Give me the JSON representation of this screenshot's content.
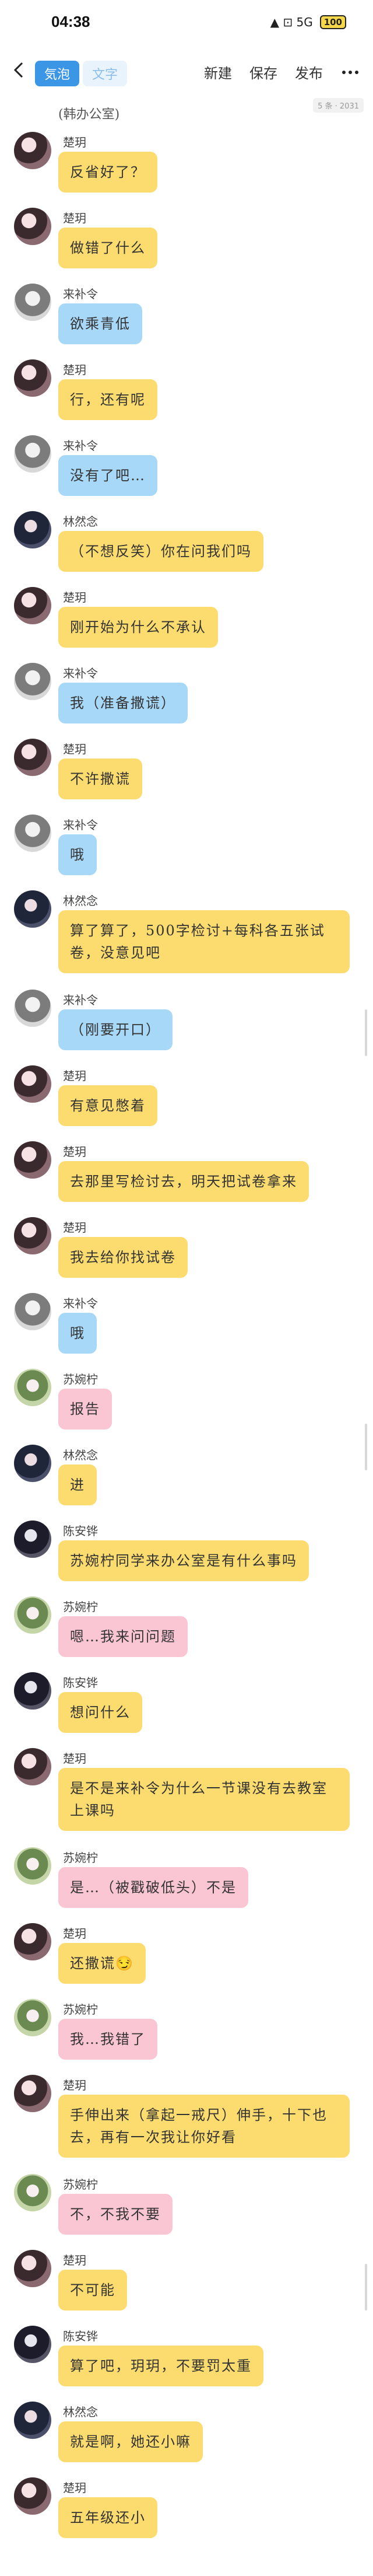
{
  "status_bar": {
    "time": "04:38",
    "signal": "▲ ⊡ 5G",
    "battery": "100"
  },
  "toolbar": {
    "tabs": [
      "気泡",
      "文字"
    ],
    "actions": [
      "新建",
      "保存",
      "发布"
    ]
  },
  "chat": {
    "title": "(韩办公室)",
    "word_count": "5 条 · 2031"
  },
  "colors": {
    "yellow": "#fcdc6e",
    "blue": "#a8d8f8",
    "pink": "#fbc6d3",
    "accent": "#3c96e6"
  },
  "messages": [
    {
      "sender": "楚玥",
      "text": "反省好了？",
      "color": "yellow",
      "avatar": "a1"
    },
    {
      "sender": "楚玥",
      "text": "做错了什么",
      "color": "yellow",
      "avatar": "a1"
    },
    {
      "sender": "来补令",
      "text": "欲乘青低",
      "color": "blue",
      "avatar": "a2"
    },
    {
      "sender": "楚玥",
      "text": "行，还有呢",
      "color": "yellow",
      "avatar": "a1"
    },
    {
      "sender": "来补令",
      "text": "没有了吧…",
      "color": "blue",
      "avatar": "a2"
    },
    {
      "sender": "林然念",
      "text": "（不想反笑）你在问我们吗",
      "color": "yellow",
      "avatar": "a3"
    },
    {
      "sender": "楚玥",
      "text": "刚开始为什么不承认",
      "color": "yellow",
      "avatar": "a1"
    },
    {
      "sender": "来补令",
      "text": "我（准备撒谎）",
      "color": "blue",
      "avatar": "a2"
    },
    {
      "sender": "楚玥",
      "text": "不许撒谎",
      "color": "yellow",
      "avatar": "a1"
    },
    {
      "sender": "来补令",
      "text": "哦",
      "color": "blue",
      "avatar": "a2"
    },
    {
      "sender": "林然念",
      "text": "算了算了，500字检讨+每科各五张试卷，没意见吧",
      "color": "yellow",
      "avatar": "a3",
      "tall": true
    },
    {
      "sender": "来补令",
      "text": "（刚要开口）",
      "color": "blue",
      "avatar": "a2"
    },
    {
      "sender": "楚玥",
      "text": "有意见憋着",
      "color": "yellow",
      "avatar": "a1"
    },
    {
      "sender": "楚玥",
      "text": "去那里写检讨去，明天把试卷拿来",
      "color": "yellow",
      "avatar": "a1"
    },
    {
      "sender": "楚玥",
      "text": "我去给你找试卷",
      "color": "yellow",
      "avatar": "a1"
    },
    {
      "sender": "来补令",
      "text": "哦",
      "color": "blue",
      "avatar": "a2"
    },
    {
      "sender": "苏婉柠",
      "text": "报告",
      "color": "pink",
      "avatar": "a4"
    },
    {
      "sender": "林然念",
      "text": "进",
      "color": "yellow",
      "avatar": "a3"
    },
    {
      "sender": "陈安铧",
      "text": "苏婉柠同学来办公室是有什么事吗",
      "color": "yellow",
      "avatar": "a5"
    },
    {
      "sender": "苏婉柠",
      "text": "嗯…我来问问题",
      "color": "pink",
      "avatar": "a4"
    },
    {
      "sender": "陈安铧",
      "text": "想问什么",
      "color": "yellow",
      "avatar": "a5"
    },
    {
      "sender": "楚玥",
      "text": "是不是来补令为什么一节课没有去教室上课吗",
      "color": "yellow",
      "avatar": "a1",
      "tall": true
    },
    {
      "sender": "苏婉柠",
      "text": "是…（被戳破低头）不是",
      "color": "pink",
      "avatar": "a4"
    },
    {
      "sender": "楚玥",
      "text": "还撒谎😏",
      "color": "yellow",
      "avatar": "a1"
    },
    {
      "sender": "苏婉柠",
      "text": "我…我错了",
      "color": "pink",
      "avatar": "a4"
    },
    {
      "sender": "楚玥",
      "text": "手伸出来（拿起一戒尺）伸手，十下也去，再有一次我让你好看",
      "color": "yellow",
      "avatar": "a1",
      "tall": true
    },
    {
      "sender": "苏婉柠",
      "text": "不，不我不要",
      "color": "pink",
      "avatar": "a4"
    },
    {
      "sender": "楚玥",
      "text": "不可能",
      "color": "yellow",
      "avatar": "a1"
    },
    {
      "sender": "陈安铧",
      "text": "算了吧，玥玥，不要罚太重",
      "color": "yellow",
      "avatar": "a5"
    },
    {
      "sender": "林然念",
      "text": "就是啊，她还小嘛",
      "color": "yellow",
      "avatar": "a3"
    },
    {
      "sender": "楚玥",
      "text": "五年级还小",
      "color": "yellow",
      "avatar": "a1"
    }
  ]
}
